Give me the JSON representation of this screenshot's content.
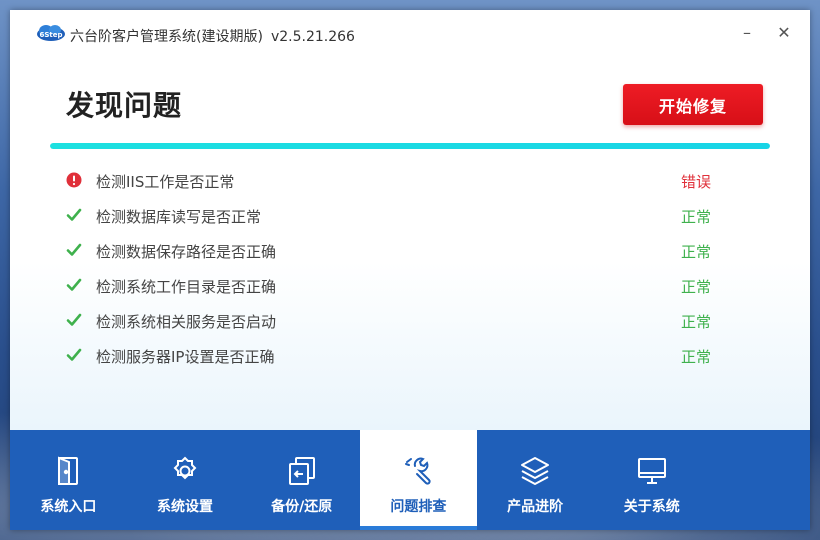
{
  "app": {
    "title": "六台阶客户管理系统(建设期版)",
    "version": "v2.5.21.266",
    "logo_icon": "cloud-logo-icon"
  },
  "window_controls": {
    "minimize": "–",
    "close": "✕"
  },
  "main": {
    "heading": "发现问题",
    "fix_button": "开始修复",
    "progress": 1.0
  },
  "checks": [
    {
      "label": "检测IIS工作是否正常",
      "status": "错误",
      "state": "error"
    },
    {
      "label": "检测数据库读写是否正常",
      "status": "正常",
      "state": "ok"
    },
    {
      "label": "检测数据保存路径是否正确",
      "status": "正常",
      "state": "ok"
    },
    {
      "label": "检测系统工作目录是否正确",
      "status": "正常",
      "state": "ok"
    },
    {
      "label": "检测系统相关服务是否启动",
      "status": "正常",
      "state": "ok"
    },
    {
      "label": "检测服务器IP设置是否正确",
      "status": "正常",
      "state": "ok"
    }
  ],
  "nav": [
    {
      "label": "系统入口",
      "icon": "door-icon",
      "active": false
    },
    {
      "label": "系统设置",
      "icon": "gear-icon",
      "active": false
    },
    {
      "label": "备份/还原",
      "icon": "backup-icon",
      "active": false
    },
    {
      "label": "问题排查",
      "icon": "wrench-icon",
      "active": true
    },
    {
      "label": "产品进阶",
      "icon": "layers-icon",
      "active": false
    },
    {
      "label": "关于系统",
      "icon": "monitor-icon",
      "active": false
    }
  ],
  "colors": {
    "nav_bg": "#1f5fb9",
    "accent_red": "#e0303a",
    "ok_green": "#3fb14d",
    "progress": "#18d4e6"
  }
}
